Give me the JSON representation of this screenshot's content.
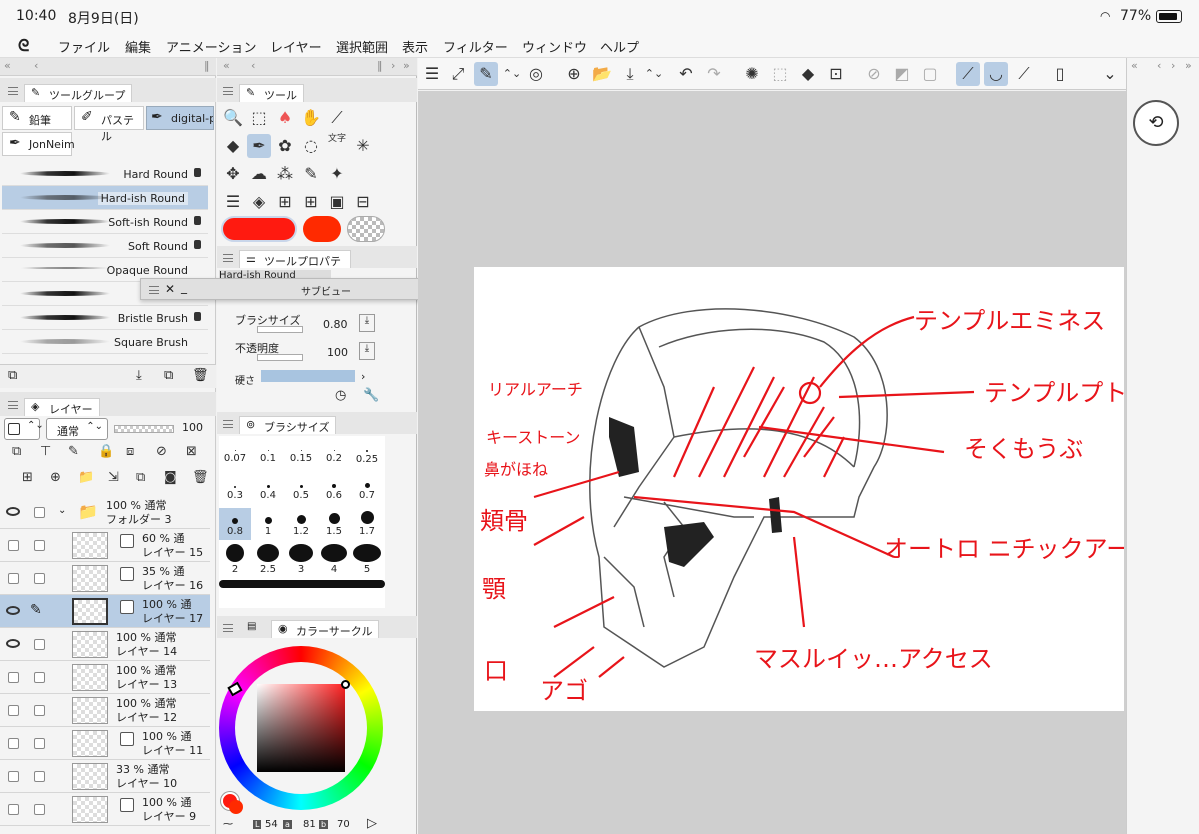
{
  "status": {
    "time": "10:40",
    "date": "8月9日(日)",
    "battery": "77%"
  },
  "menu": [
    "ファイル",
    "編集",
    "アニメーション",
    "レイヤー",
    "選択範囲",
    "表示",
    "フィルター",
    "ウィンドウ",
    "ヘルプ"
  ],
  "tool_group": {
    "title": "ツールグループ",
    "tabs": [
      "鉛筆",
      "パステル",
      "digital-p",
      "JonNeim"
    ],
    "brushes": [
      "Hard Round",
      "Hard-ish Round",
      "Soft-ish Round",
      "Soft Round",
      "Opaque Round",
      "",
      "Bristle Brush",
      "Square Brush"
    ]
  },
  "tool": {
    "title": "ツール",
    "text_tool": "文字"
  },
  "tool_property": {
    "title": "ツールプロパティ",
    "current": "Hard-ish Round",
    "brush_size_label": "ブラシサイズ",
    "brush_size": "0.80",
    "opacity_label": "不透明度",
    "opacity": "100",
    "hardness_label": "硬さ"
  },
  "subview": {
    "title": "サブビュー"
  },
  "layer_panel": {
    "title": "レイヤー",
    "blend": "通常",
    "opacity": "100",
    "layers": [
      {
        "pct": "100 %",
        "mode": "通常",
        "name": "フォルダー 3"
      },
      {
        "pct": "60 %",
        "mode": "通",
        "name": "レイヤー 15"
      },
      {
        "pct": "35 %",
        "mode": "通",
        "name": "レイヤー 16"
      },
      {
        "pct": "100 %",
        "mode": "通",
        "name": "レイヤー 17"
      },
      {
        "pct": "100 %",
        "mode": "通常",
        "name": "レイヤー 14"
      },
      {
        "pct": "100 %",
        "mode": "通常",
        "name": "レイヤー 13"
      },
      {
        "pct": "100 %",
        "mode": "通常",
        "name": "レイヤー 12"
      },
      {
        "pct": "100 %",
        "mode": "通",
        "name": "レイヤー 11"
      },
      {
        "pct": "33 %",
        "mode": "通常",
        "name": "レイヤー 10"
      },
      {
        "pct": "100 %",
        "mode": "通",
        "name": "レイヤー 9"
      }
    ]
  },
  "brush_size_panel": {
    "title": "ブラシサイズ",
    "sizes": [
      "0.07",
      "0.1",
      "0.15",
      "0.2",
      "0.25",
      "0.3",
      "0.4",
      "0.5",
      "0.6",
      "0.7",
      "0.8",
      "1",
      "1.2",
      "1.5",
      "1.7",
      "2",
      "2.5",
      "3",
      "4",
      "5"
    ]
  },
  "color_circle": {
    "title": "カラーサークル",
    "L": "54",
    "a": "81",
    "b": "70",
    "main_color": "#ff2a1a"
  },
  "annotations": [
    "テンプルエミネス",
    "テンプルプトス",
    "リアルアーチ",
    "キーストーン",
    "鼻がほね",
    "頬骨",
    "顎",
    "口",
    "アゴ",
    "そくもうぶ",
    "オートロ ニチックアーチ",
    "マスルイッ…アクセス"
  ]
}
